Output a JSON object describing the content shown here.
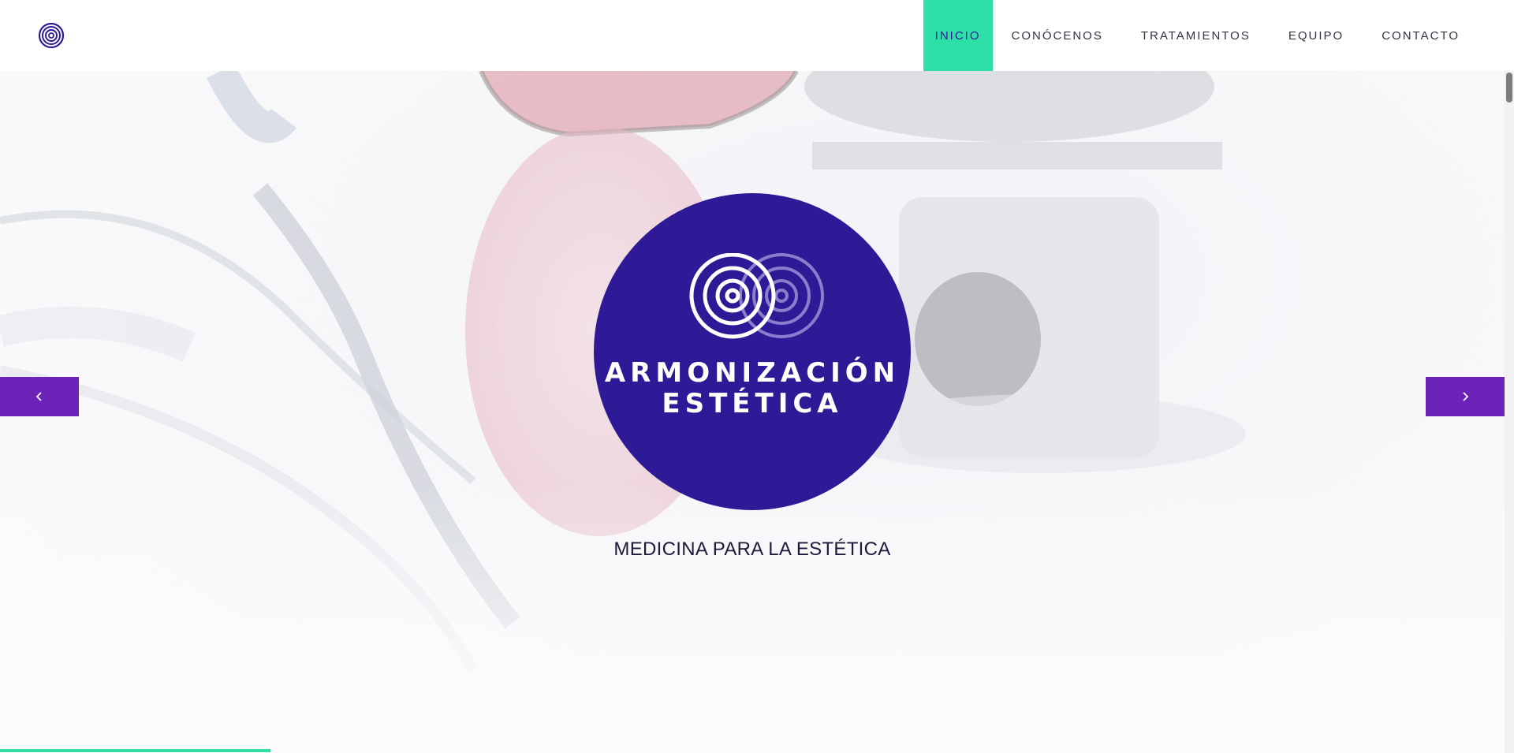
{
  "header": {
    "logo_icon": "concentric-rings-icon",
    "nav": [
      {
        "label": "INICIO",
        "active": true
      },
      {
        "label": "CONÓCENOS",
        "active": false
      },
      {
        "label": "TRATAMIENTOS",
        "active": false
      },
      {
        "label": "EQUIPO",
        "active": false
      },
      {
        "label": "CONTACTO",
        "active": false
      }
    ]
  },
  "hero": {
    "brand_line1": "ARMONIZACIÓN",
    "brand_line2": "ESTÉTICA",
    "tagline": "MEDICINA PARA LA ESTÉTICA",
    "prev_icon": "chevron-left-icon",
    "next_icon": "chevron-right-icon",
    "slide_progress": 0.18
  },
  "colors": {
    "brand_purple": "#2e1a96",
    "accent_green": "#2ee0a7",
    "arrow_purple": "#6b23b8"
  }
}
